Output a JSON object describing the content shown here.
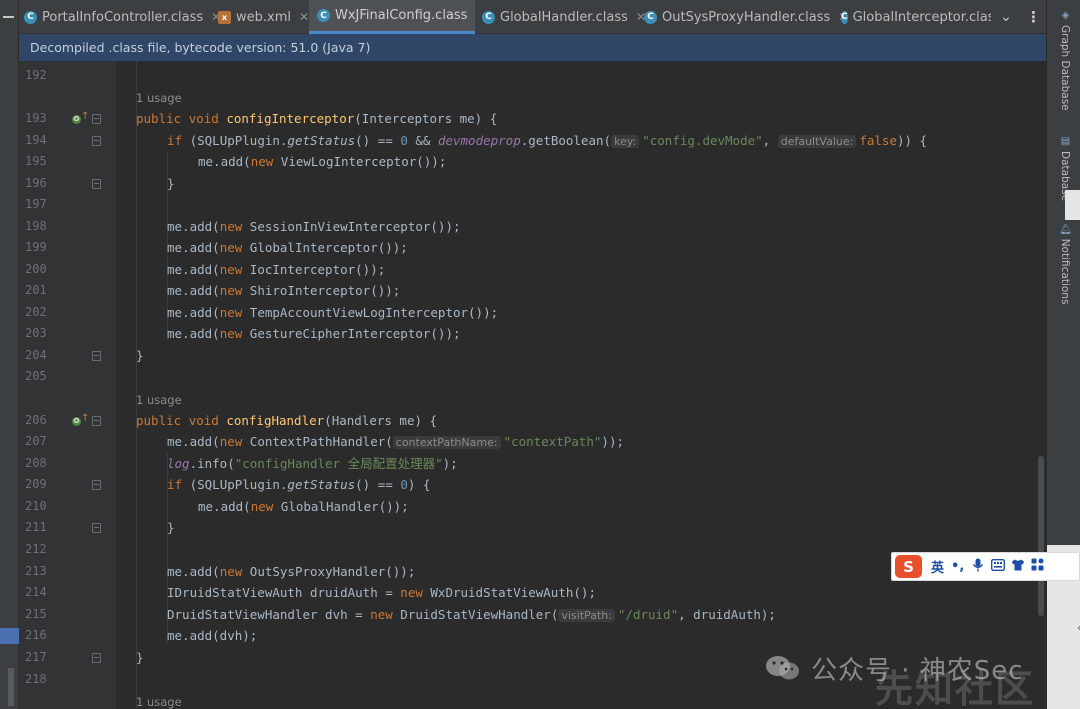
{
  "tabs": [
    {
      "label": "PortalInfoController.class",
      "icon": "class-icon",
      "active": false
    },
    {
      "label": "web.xml",
      "icon": "xml-file-icon",
      "active": false
    },
    {
      "label": "WxJFinalConfig.class",
      "icon": "class-icon",
      "active": true
    },
    {
      "label": "GlobalHandler.class",
      "icon": "class-icon",
      "active": false
    },
    {
      "label": "OutSysProxyHandler.class",
      "icon": "class-icon",
      "active": false
    },
    {
      "label": "GlobalInterceptor.class",
      "icon": "class-icon",
      "active": false
    }
  ],
  "banner": {
    "text": "Decompiled .class file, bytecode version: 51.0 (Java 7)"
  },
  "usage_label": "1 usage",
  "line_numbers": [
    "192",
    "193",
    "194",
    "195",
    "196",
    "197",
    "198",
    "199",
    "200",
    "201",
    "202",
    "203",
    "204",
    "205",
    "206",
    "207",
    "208",
    "209",
    "210",
    "211",
    "212",
    "213",
    "214",
    "215",
    "216",
    "217",
    "218"
  ],
  "code": {
    "configInterceptor": {
      "kw_public": "public",
      "kw_void": "void",
      "name": "configInterceptor",
      "params": "(Interceptors me) {",
      "if_kw": "if",
      "if_pre": " (SQLUpPlugin.",
      "getStatus": "getStatus",
      "if_mid": "() == ",
      "zero": "0",
      "and": " && ",
      "devmodeprop": "devmodeprop",
      "getBoolean": ".getBoolean(",
      "hint_key": "key:",
      "str_devmode": "\"config.devMode\"",
      "comma": ", ",
      "hint_default": "defaultValue:",
      "kw_false": "false",
      "if_end": ")) {",
      "add_view": "me.add(",
      "new": "new",
      "view": " ViewLogInterceptor());",
      "close_brace": "}",
      "lines": [
        " SessionInViewInterceptor());",
        " GlobalInterceptor());",
        " IocInterceptor());",
        " ShiroInterceptor());",
        " TempAccountViewLogInterceptor());",
        " GestureCipherInterceptor());"
      ]
    },
    "configHandler": {
      "name": "configHandler",
      "params": "(Handlers me) {",
      "ctx_pre": " ContextPathHandler(",
      "hint_ctx": "contextPathName:",
      "str_ctx": "\"contextPath\"",
      "ctx_end": "));",
      "log": "log",
      "info": ".info(",
      "str_log": "\"configHandler 全局配置处理器\"",
      "log_end": ");",
      "if_end": ") {",
      "global": " GlobalHandler());",
      "outsys": " OutSysProxyHandler());",
      "druid_type": "IDruidStatViewAuth druidAuth = ",
      "druid_new": " WxDruidStatViewAuth();",
      "dvh_type": "DruidStatViewHandler dvh = ",
      "dvh_new": " DruidStatViewHandler(",
      "hint_visit": "visitPath:",
      "str_druid": "\"/druid\"",
      "dvh_end": ", druidAuth);",
      "add_dvh": "me.add(dvh);"
    }
  },
  "right_tools": [
    "Graph Database",
    "Database",
    "Notifications"
  ],
  "ime": {
    "logo": "S",
    "lang": "英",
    "punct": "•,",
    "icons": [
      "microphone-icon",
      "keyboard-icon",
      "skin-icon",
      "toolbox-icon"
    ]
  },
  "watermark": {
    "text": "公众号 · 神农Sec",
    "overlay": "先知社区"
  },
  "colors": {
    "accent": "#4a88c7",
    "banner": "#2f4667",
    "keyword": "#cc7832",
    "function": "#ffc66d",
    "string": "#6a8759",
    "number": "#6897bb"
  }
}
